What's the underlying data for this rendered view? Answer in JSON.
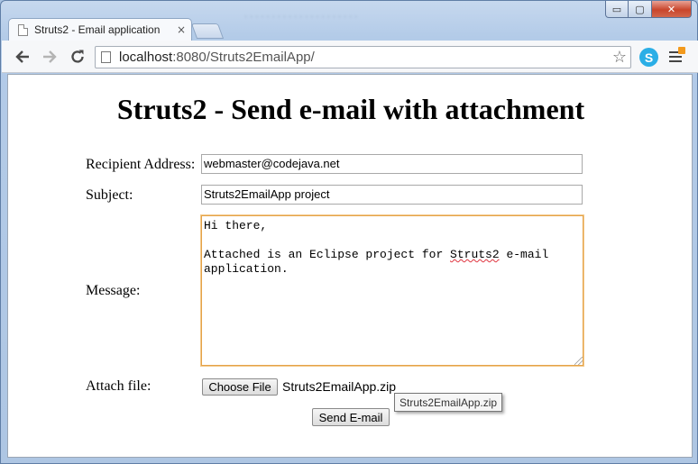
{
  "browser": {
    "tab_title": "Struts2 - Email application",
    "tab_close": "×",
    "url_host": "localhost",
    "url_rest": ":8080/Struts2EmailApp/",
    "back_icon": "arrow-left-icon",
    "forward_icon": "arrow-right-icon",
    "reload_icon": "reload-icon",
    "star_icon": "star-icon",
    "skype_icon": "skype-icon",
    "menu_icon": "hamburger-menu-icon",
    "window_controls": {
      "minimize": "▭",
      "maximize": "▢",
      "close": "✕"
    }
  },
  "page": {
    "title": "Struts2 - Send e-mail with attachment",
    "form": {
      "recipient_label": "Recipient Address:",
      "recipient_value": "webmaster@codejava.net",
      "subject_label": "Subject:",
      "subject_value": "Struts2EmailApp project",
      "message_label": "Message:",
      "message_line1": "Hi there,",
      "message_line3_prefix": "Attached is an Eclipse project for ",
      "message_line3_misspelled": "Struts2",
      "message_line3_suffix": " e-mail",
      "message_line4": "application.",
      "attach_label": "Attach file:",
      "choose_file_label": "Choose File",
      "chosen_file_name": "Struts2EmailApp.zip",
      "tooltip_text": "Struts2EmailApp.zip",
      "submit_label": "Send E-mail"
    }
  },
  "colors": {
    "focus_border": "#e5a349",
    "spellcheck_underline": "#e0343f",
    "skype_blue": "#2aaee6",
    "close_red": "#c9462c"
  }
}
